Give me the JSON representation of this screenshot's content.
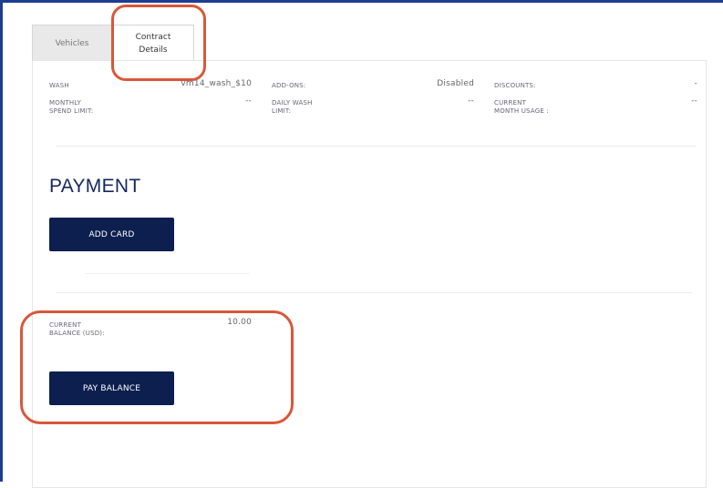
{
  "tabs": [
    {
      "label": "Vehicles"
    },
    {
      "label": "Contract\nDetails"
    }
  ],
  "contract": {
    "wash_label": "WASH",
    "wash_value": "vm14_wash_$10",
    "addons_label": "ADD-ONS:",
    "addons_value": "Disabled",
    "discounts_label": "DISCOUNTS:",
    "discounts_value": "-",
    "monthly_label": "MONTHLY\nSPEND LIMIT:",
    "monthly_value": "--",
    "daily_label": "DAILY WASH\nLIMIT:",
    "daily_value": "--",
    "current_usage_label": "CURRENT\nMONTH USAGE :",
    "current_usage_value": "--"
  },
  "payment": {
    "title": "PAYMENT",
    "add_card_label": "ADD CARD"
  },
  "balance": {
    "label": "CURRENT\nBALANCE (USD):",
    "value": "10.00",
    "pay_button_label": "PAY BALANCE"
  },
  "colors": {
    "frame": "#1d3d8e",
    "button": "#0d1f4f",
    "highlight": "#d9573a",
    "title": "#14275f"
  }
}
